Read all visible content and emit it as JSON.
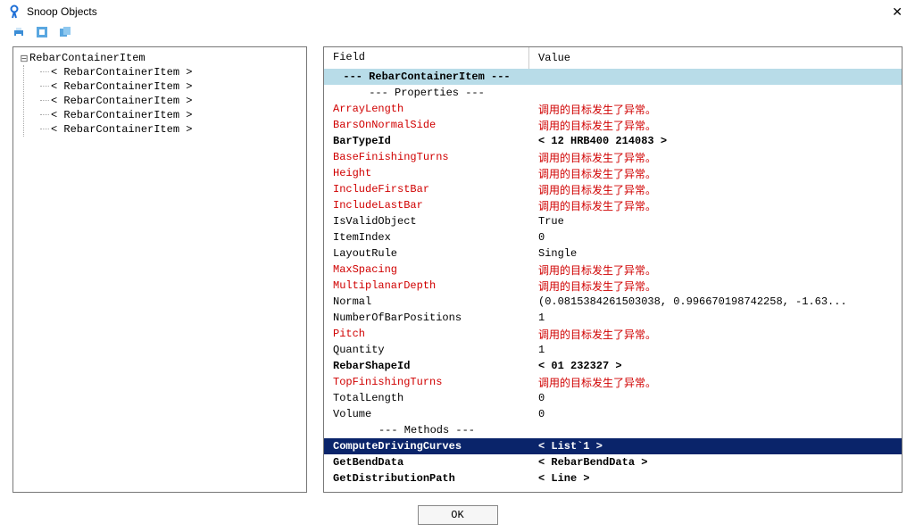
{
  "window": {
    "title": "Snoop Objects",
    "close_glyph": "✕"
  },
  "toolbar": {
    "print": "🖶",
    "copy1": "▣",
    "copy2": "⧉"
  },
  "tree": {
    "root_label": "RebarContainerItem",
    "toggle_glyph": "⊟",
    "children": [
      "< RebarContainerItem >",
      "< RebarContainerItem >",
      "< RebarContainerItem >",
      "< RebarContainerItem >",
      "< RebarContainerItem >"
    ]
  },
  "header": {
    "field": "Field",
    "value": "Value"
  },
  "sections": {
    "class": " --- RebarContainerItem --- ",
    "props": " --- Properties --- ",
    "methods": " --- Methods --- "
  },
  "rows": [
    {
      "f": "ArrayLength",
      "v": "调用的目标发生了异常。",
      "cls": "err"
    },
    {
      "f": "BarsOnNormalSide",
      "v": "调用的目标发生了异常。",
      "cls": "err"
    },
    {
      "f": "BarTypeId",
      "v": "< 12 HRB400  214083 >",
      "cls": "bold"
    },
    {
      "f": "BaseFinishingTurns",
      "v": "调用的目标发生了异常。",
      "cls": "err"
    },
    {
      "f": "Height",
      "v": "调用的目标发生了异常。",
      "cls": "err"
    },
    {
      "f": "IncludeFirstBar",
      "v": "调用的目标发生了异常。",
      "cls": "err"
    },
    {
      "f": "IncludeLastBar",
      "v": "调用的目标发生了异常。",
      "cls": "err"
    },
    {
      "f": "IsValidObject",
      "v": "True",
      "cls": ""
    },
    {
      "f": "ItemIndex",
      "v": "0",
      "cls": ""
    },
    {
      "f": "LayoutRule",
      "v": "Single",
      "cls": ""
    },
    {
      "f": "MaxSpacing",
      "v": "调用的目标发生了异常。",
      "cls": "err"
    },
    {
      "f": "MultiplanarDepth",
      "v": "调用的目标发生了异常。",
      "cls": "err"
    },
    {
      "f": "Normal",
      "v": "(0.0815384261503038, 0.996670198742258, -1.63...",
      "cls": ""
    },
    {
      "f": "NumberOfBarPositions",
      "v": "1",
      "cls": ""
    },
    {
      "f": "Pitch",
      "v": "调用的目标发生了异常。",
      "cls": "err"
    },
    {
      "f": "Quantity",
      "v": "1",
      "cls": ""
    },
    {
      "f": "RebarShapeId",
      "v": "< 01  232327 >",
      "cls": "bold"
    },
    {
      "f": "TopFinishingTurns",
      "v": "调用的目标发生了异常。",
      "cls": "err"
    },
    {
      "f": "TotalLength",
      "v": "0",
      "cls": ""
    },
    {
      "f": "Volume",
      "v": "0",
      "cls": ""
    }
  ],
  "methods": [
    {
      "f": "ComputeDrivingCurves",
      "v": "< List`1 >",
      "cls": "sel"
    },
    {
      "f": "GetBendData",
      "v": "< RebarBendData >",
      "cls": "bold"
    },
    {
      "f": "GetDistributionPath",
      "v": "< Line >",
      "cls": "bold"
    }
  ],
  "buttons": {
    "ok": "OK"
  }
}
